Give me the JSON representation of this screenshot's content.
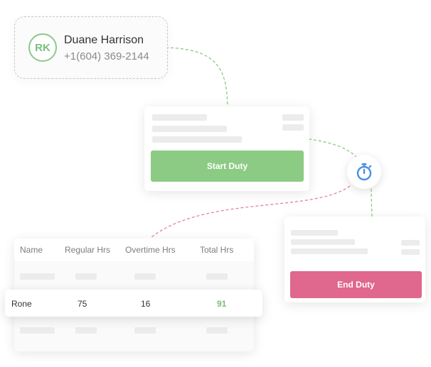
{
  "contact": {
    "initials": "RK",
    "name": "Duane Harrison",
    "phone": "+1(604) 369-2144"
  },
  "start_panel": {
    "button_label": "Start Duty"
  },
  "end_panel": {
    "button_label": "End Duty"
  },
  "timer": {
    "icon": "stopwatch-icon"
  },
  "table": {
    "columns": [
      "Name",
      "Regular Hrs",
      "Overtime Hrs",
      "Total Hrs"
    ],
    "highlighted_row": {
      "name": "Rone",
      "regular": "75",
      "overtime": "16",
      "total": "91"
    }
  },
  "colors": {
    "start_green": "#8ccb84",
    "end_pink": "#e0678d",
    "accent_green": "#7bbf79",
    "timer_blue": "#4a90e2"
  }
}
